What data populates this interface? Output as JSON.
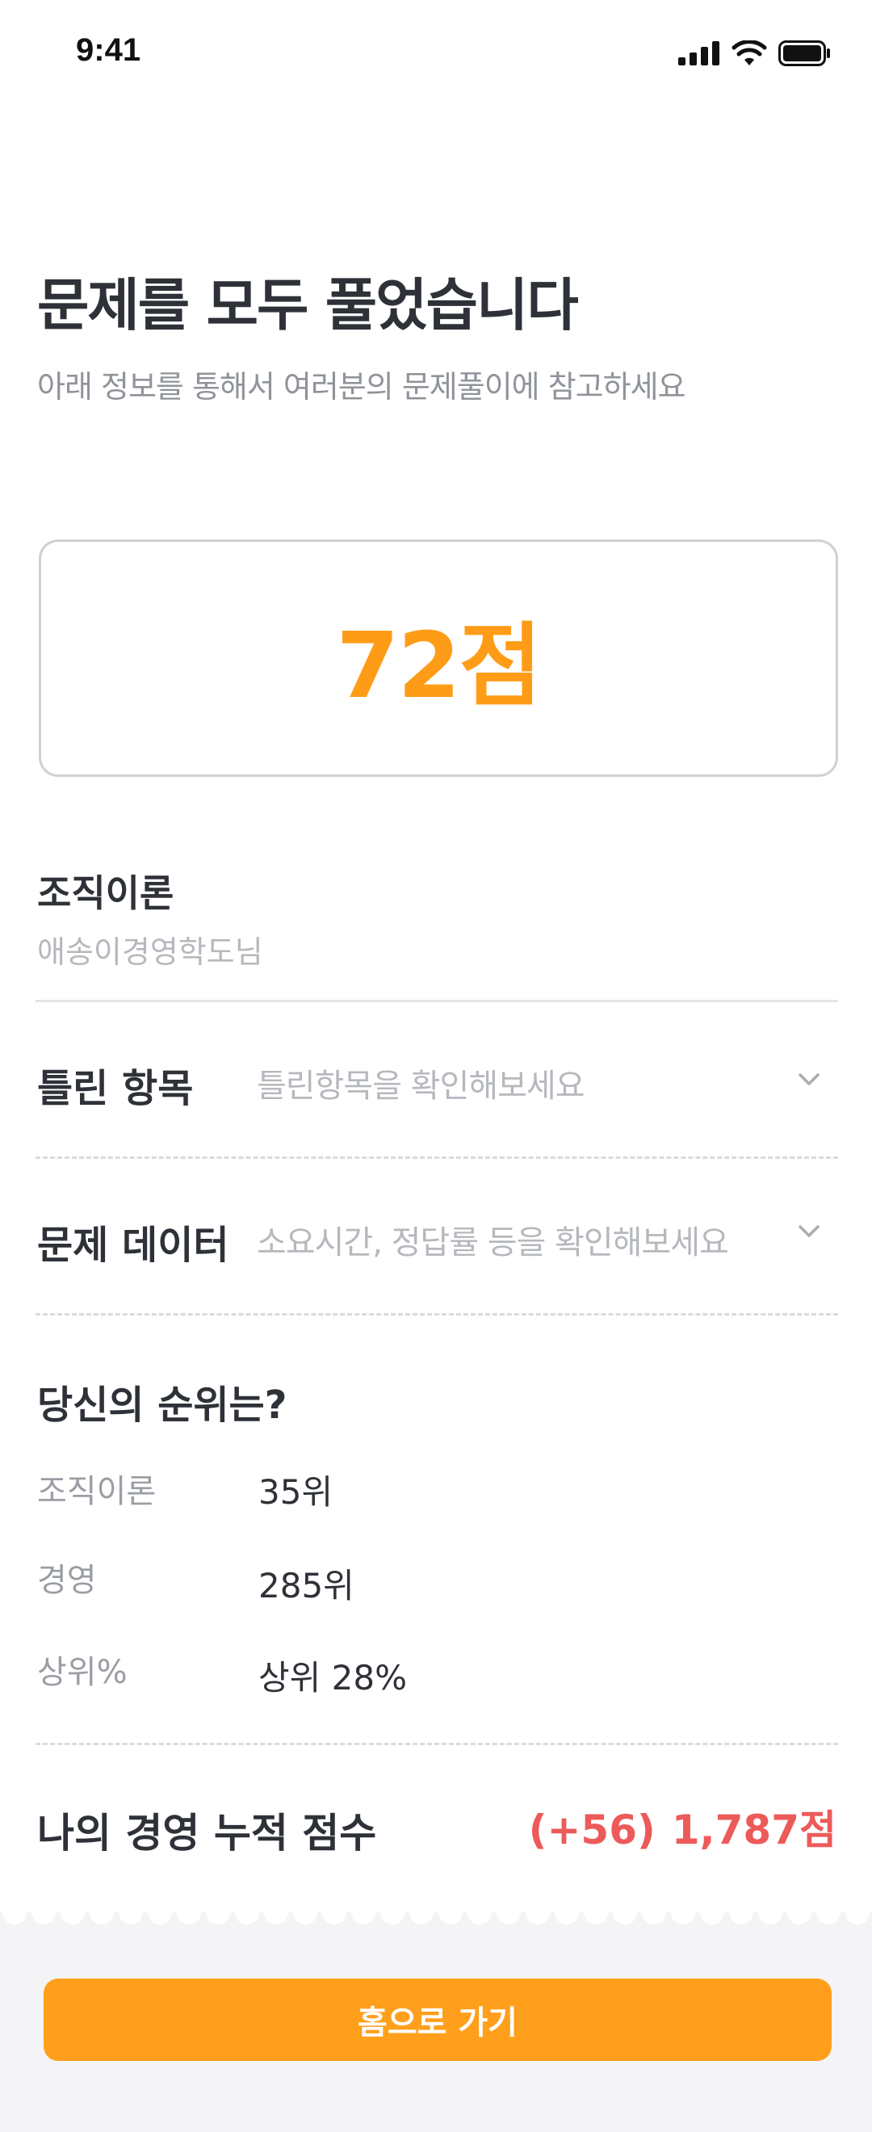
{
  "status_bar": {
    "time": "9:41"
  },
  "header": {
    "title": "문제를 모두 풀었습니다",
    "subtitle": "아래 정보를 통해서 여러분의 문제풀이에 참고하세요"
  },
  "result": {
    "score": "72점",
    "subject": "조직이론",
    "user": "애송이경영학도님"
  },
  "sections": [
    {
      "label": "틀린 항목",
      "hint": "틀린항목을 확인해보세요",
      "icon": "chevron-down-icon"
    },
    {
      "label": "문제 데이터",
      "hint": "소요시간, 정답률 등을 확인해보세요",
      "icon": "chevron-down-icon"
    }
  ],
  "ranking": {
    "title": "당신의 순위는?",
    "rows": [
      {
        "label": "조직이론",
        "value": "35위"
      },
      {
        "label": "경영",
        "value": "285위"
      },
      {
        "label": "상위%",
        "value": "상위 28%"
      }
    ]
  },
  "total": {
    "label": "나의 경영 누적 점수",
    "delta": "(+56)",
    "score": "1,787점"
  },
  "actions": {
    "home_button": "홈으로 가기"
  },
  "colors": {
    "accent": "#ff9f1c",
    "score": "#ff9c17",
    "highlight": "#ed5a5a",
    "muted": "#b5b8bd"
  }
}
